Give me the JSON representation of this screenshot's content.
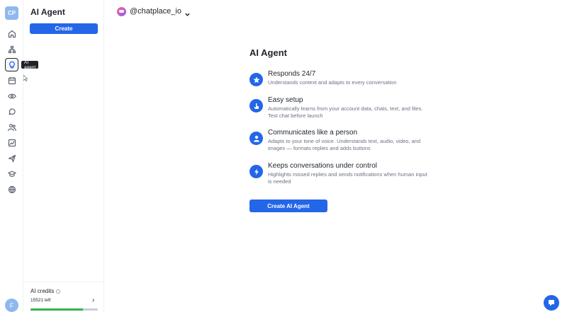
{
  "rail": {
    "avatar_initials": "CP",
    "tooltip": "AI agent",
    "user_initial": "F",
    "icons": [
      "home-icon",
      "org-chart-icon",
      "lightbulb-icon",
      "calendar-icon",
      "eye-icon",
      "chat-icon",
      "users-icon",
      "analytics-icon",
      "send-icon",
      "graduation-icon",
      "globe-icon"
    ]
  },
  "panel": {
    "title": "AI Agent",
    "create_label": "Create",
    "credits_label": "AI credits",
    "credits_left": "15521 left",
    "credits_fraction": 0.78,
    "credit_color": "#35b24a"
  },
  "account": {
    "name": "@chatplace_io"
  },
  "main": {
    "title": "AI Agent",
    "features": [
      {
        "title": "Responds 24/7",
        "desc": "Understands context and adapts to every conversation",
        "icon": "star-icon"
      },
      {
        "title": "Easy setup",
        "desc": "Automatically learns from your account data, chats, text, and files. Test chat before launch",
        "icon": "hand-pointer-icon"
      },
      {
        "title": "Communicates like a person",
        "desc": "Adapts to your tone of voice. Understands text, audio, video, and images — formats replies and adds buttons",
        "icon": "person-icon"
      },
      {
        "title": "Keeps conversations under control",
        "desc": "Highlights missed replies and sends notifications when human input is needed",
        "icon": "lightning-icon"
      }
    ],
    "cta_label": "Create AI Agent"
  },
  "colors": {
    "accent": "#2366e8"
  }
}
